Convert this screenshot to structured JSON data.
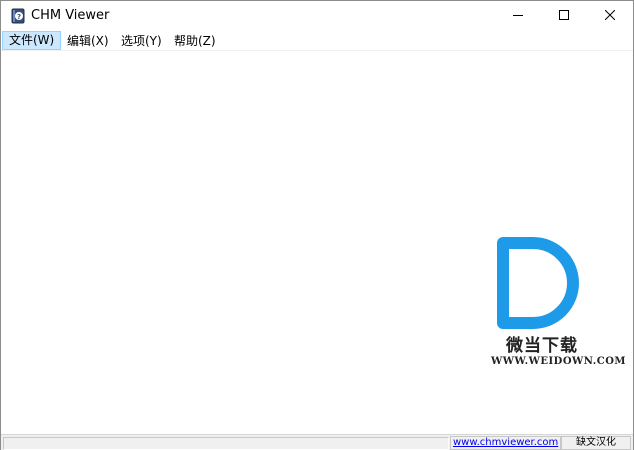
{
  "window": {
    "title": "CHM Viewer",
    "icon": "chm-help-icon",
    "controls": [
      "minimize-icon",
      "maximize-icon",
      "close-icon"
    ]
  },
  "menu": {
    "items": [
      {
        "label": "文件(W)",
        "active": true
      },
      {
        "label": "编辑(X)",
        "active": false
      },
      {
        "label": "选项(Y)",
        "active": false
      },
      {
        "label": "帮助(Z)",
        "active": false
      }
    ]
  },
  "watermark": {
    "cn": "微当下载",
    "en": "WWW.WEIDOWN.COM",
    "color": "#1e9be8"
  },
  "status": {
    "main": "",
    "link": "www.chmviewer.com",
    "credit": "缺文汉化"
  },
  "colors": {
    "menu_active_bg": "#cce8ff",
    "link": "#0000ee",
    "status_bg": "#f0f0f0"
  }
}
